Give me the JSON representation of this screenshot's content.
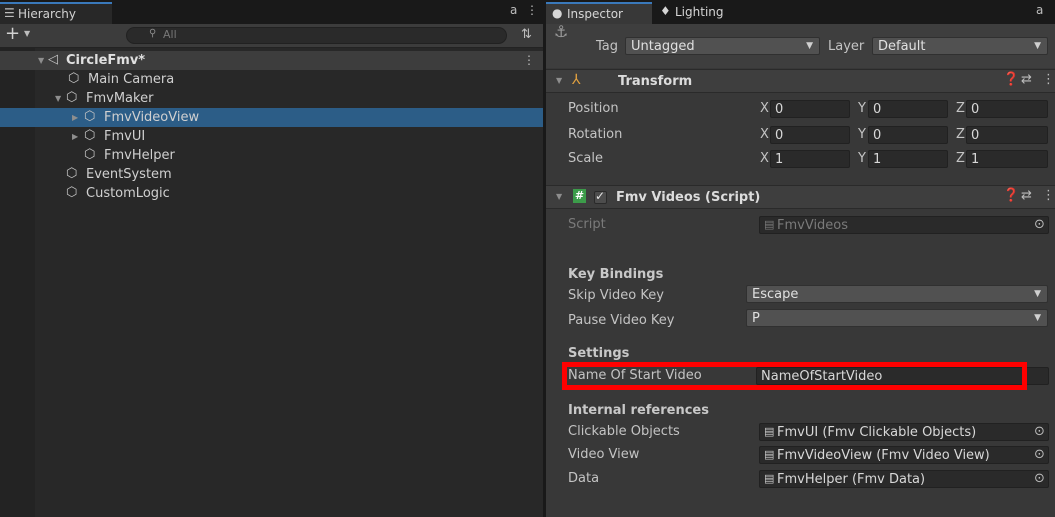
{
  "hierarchy": {
    "tab_icon": "list-tree-icon",
    "tab_label": "Hierarchy",
    "tab_lock_glyph": "a",
    "tab_menu_glyph": "⋮",
    "search_placeholder": "All",
    "items": [
      {
        "name": "CircleFmv*",
        "icon": "unity-scene-icon",
        "expanded": true
      },
      {
        "name": "Main Camera",
        "icon": "gameobject-cube-icon"
      },
      {
        "name": "FmvMaker",
        "icon": "gameobject-cube-icon",
        "expanded": true
      },
      {
        "name": "FmvVideoView",
        "icon": "gameobject-cube-icon",
        "expanded": false
      },
      {
        "name": "FmvUI",
        "icon": "gameobject-cube-icon",
        "expanded": false
      },
      {
        "name": "FmvHelper",
        "icon": "gameobject-cube-icon"
      },
      {
        "name": "EventSystem",
        "icon": "gameobject-cube-icon"
      },
      {
        "name": "CustomLogic",
        "icon": "gameobject-cube-icon"
      }
    ]
  },
  "inspector": {
    "tabs": [
      {
        "label": "Inspector",
        "icon": "info-circle-icon"
      },
      {
        "label": "Lighting",
        "icon": "lightbulb-icon"
      }
    ],
    "tab_lock_glyph": "a",
    "tag_label": "Tag",
    "tag_value": "Untagged",
    "layer_label": "Layer",
    "layer_value": "Default",
    "transform": {
      "title": "Transform",
      "position": {
        "label": "Position",
        "x": "0",
        "y": "0",
        "z": "0"
      },
      "rotation": {
        "label": "Rotation",
        "x": "0",
        "y": "0",
        "z": "0"
      },
      "scale": {
        "label": "Scale",
        "x": "1",
        "y": "1",
        "z": "1"
      },
      "axes": {
        "x": "X",
        "y": "Y",
        "z": "Z"
      }
    },
    "fmv_videos": {
      "title": "Fmv Videos (Script)",
      "enabled": true,
      "script_label": "Script",
      "script_value": "FmvVideos",
      "key_bindings_header": "Key Bindings",
      "skip_label": "Skip Video Key",
      "skip_value": "Escape",
      "pause_label": "Pause Video Key",
      "pause_value": "P",
      "settings_header": "Settings",
      "start_label": "Name Of Start Video",
      "start_value": "NameOfStartVideo",
      "internal_header": "Internal references",
      "clickable_label": "Clickable Objects",
      "clickable_value": "FmvUI (Fmv Clickable Objects)",
      "video_view_label": "Video View",
      "video_view_value": "FmvVideoView (Fmv Video View)",
      "data_label": "Data",
      "data_value": "FmvHelper (Fmv Data)"
    }
  },
  "colors": {
    "selection": "#2c5d87",
    "highlight_box": "#ff0000",
    "tab_accent": "#3a79bb"
  }
}
